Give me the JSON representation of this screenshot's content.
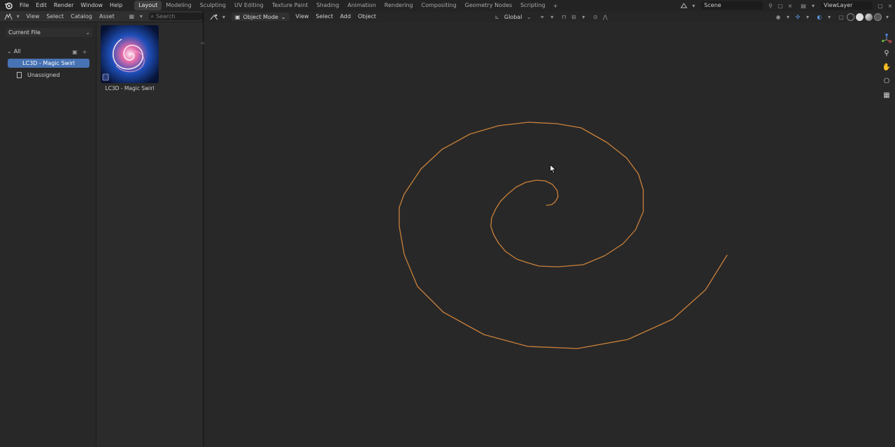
{
  "topbar": {
    "menus": [
      "File",
      "Edit",
      "Render",
      "Window",
      "Help"
    ],
    "workspaces": [
      "Layout",
      "Modeling",
      "Sculpting",
      "UV Editing",
      "Texture Paint",
      "Shading",
      "Animation",
      "Rendering",
      "Compositing",
      "Geometry Nodes",
      "Scripting"
    ],
    "active_workspace": "Layout",
    "add_tab": "+",
    "scene": "Scene",
    "view_layer": "ViewLayer"
  },
  "asset_browser": {
    "menus": [
      "View",
      "Select",
      "Catalog",
      "Asset"
    ],
    "search_placeholder": "Search",
    "library": "Current File",
    "catalog_root": "All",
    "catalogs": [
      "LC3D - Magic Swirl",
      "Unassigned"
    ],
    "active_catalog": "LC3D - Magic Swirl",
    "assets": [
      {
        "name": "LC3D - Magic Swirl"
      }
    ]
  },
  "viewport": {
    "mode": "Object Mode",
    "menus": [
      "View",
      "Select",
      "Add",
      "Object"
    ],
    "transform_orientation": "Global",
    "curve_color": "#c9803a"
  },
  "colors": {
    "accent": "#4772b3",
    "background": "#282828"
  }
}
